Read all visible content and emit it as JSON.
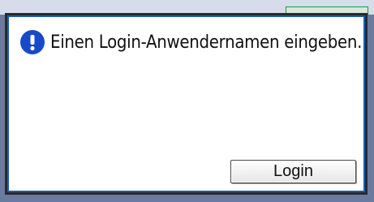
{
  "dialog": {
    "icon": "exclamation-alert-icon",
    "message": "Einen Login-Anwendernamen eingeben.",
    "button_label": "Login"
  },
  "colors": {
    "icon": "#1749c9",
    "dialog_border": "#1c5bb3"
  }
}
